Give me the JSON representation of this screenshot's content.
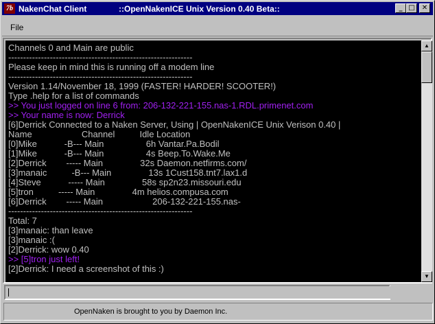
{
  "window": {
    "app_title": "NakenChat Client",
    "server_title": "::OpenNakenICE Unix Version 0.40 Beta::",
    "icon_glyph": "7b"
  },
  "titlebar_buttons": {
    "minimize": "_",
    "maximize": "□",
    "close": "✕"
  },
  "menu": {
    "file_label": "File"
  },
  "console": {
    "text_color": "#c0c0c0",
    "system_color": "#a020f0",
    "lines": [
      {
        "text": "Channels 0 and Main are public",
        "purple": false
      },
      {
        "text": "--------------------------------------------------------------",
        "purple": false
      },
      {
        "text": "Please keep in mind this is running off a modem line",
        "purple": false
      },
      {
        "text": "--------------------------------------------------------------",
        "purple": false
      },
      {
        "text": "Version 1.14/November 18, 1999 (FASTER! HARDER! SCOOTER!)",
        "purple": false
      },
      {
        "text": "Type .help for a list of commands",
        "purple": false
      },
      {
        "text": ">> You just logged on line 6 from: 206-132-221-155.nas-1.RDL.primenet.com",
        "purple": true
      },
      {
        "text": ">> Your name is now: Derrick",
        "purple": true
      },
      {
        "text": "[6]Derrick Connected to a Naken Server, Using | OpenNakenICE Unix Verison 0.40 |",
        "purple": false
      },
      {
        "text": "Name                    Channel          Idle Location",
        "purple": false
      },
      {
        "text": "[0]Mike           -B--- Main                 6h Vantar.Pa.Bodil",
        "purple": false
      },
      {
        "text": "[1]Mike           -B--- Main                 4s Beep.To.Wake.Me",
        "purple": false
      },
      {
        "text": "[2]Derrick        ----- Main               32s Daemon.netfirms.com/",
        "purple": false
      },
      {
        "text": "[3]manaic          -B--- Main               13s 1Cust158.tnt7.lax1.d",
        "purple": false
      },
      {
        "text": "[4]Steve           ----- Main               58s sp2n23.missouri.edu",
        "purple": false
      },
      {
        "text": "[5]tron          ----- Main               4m helios.compusa.com",
        "purple": false
      },
      {
        "text": "[6]Derrick        ----- Main                    206-132-221-155.nas-",
        "purple": false
      },
      {
        "text": "--------------------------------------------------------------",
        "purple": false
      },
      {
        "text": "Total: 7",
        "purple": false
      },
      {
        "text": "[3]manaic: than leave",
        "purple": false
      },
      {
        "text": "[3]manaic :(",
        "purple": false
      },
      {
        "text": "[2]Derrick: wow 0.40",
        "purple": false
      },
      {
        "text": ">> [5]tron just left!",
        "purple": true
      },
      {
        "text": "[2]Derrick: I need a screenshot of this :)",
        "purple": false
      }
    ]
  },
  "input": {
    "value": "",
    "placeholder": ""
  },
  "status": {
    "text": "OpenNaken is brought to you by Daemon Inc."
  }
}
